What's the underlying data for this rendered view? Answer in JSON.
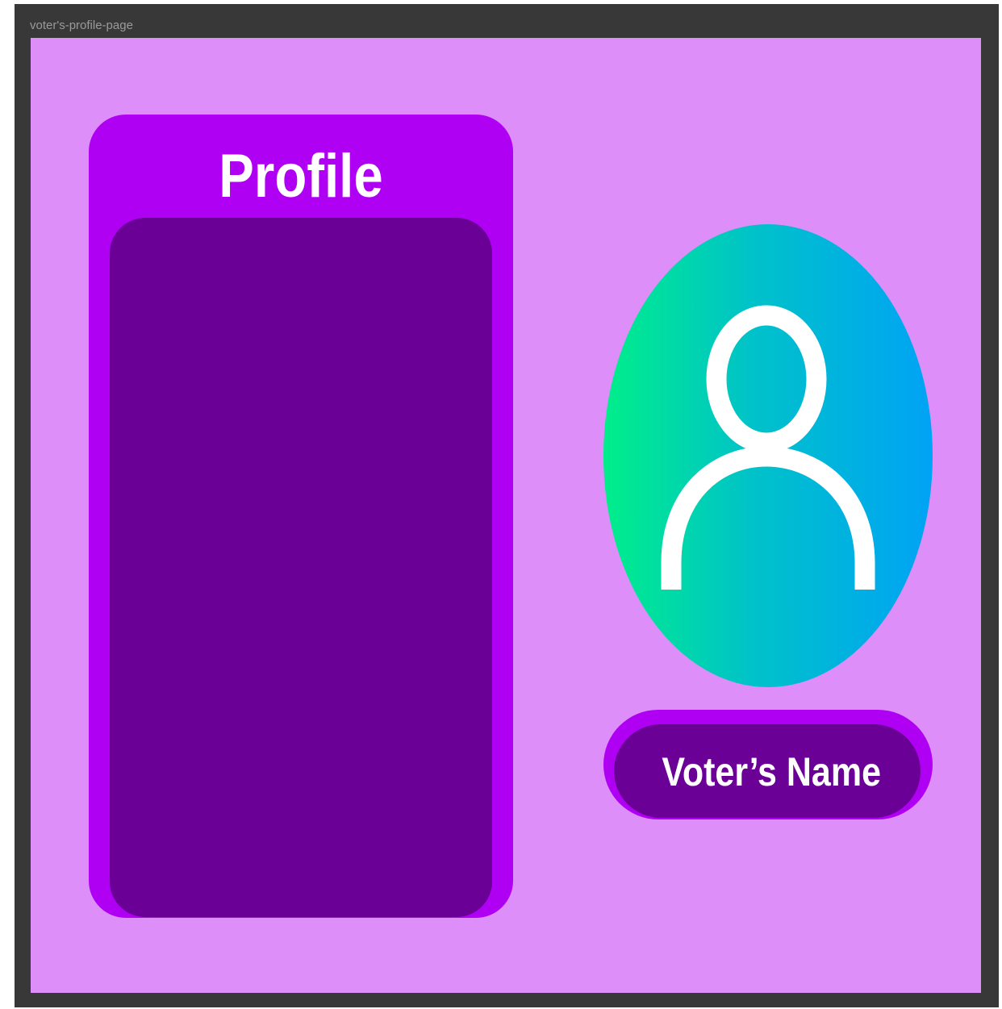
{
  "frame": {
    "label": "voter's-profile-page"
  },
  "profile": {
    "title": "Profile"
  },
  "avatar": {
    "icon": "user-icon"
  },
  "voter": {
    "name": "Voter’s Name"
  },
  "colors": {
    "canvas": "#dd8ef9",
    "card": "#b000f3",
    "card_inner": "#6b0096",
    "avatar_gradient_start": "#00ee8a",
    "avatar_gradient_end": "#00a3f5",
    "frame": "#383838"
  }
}
